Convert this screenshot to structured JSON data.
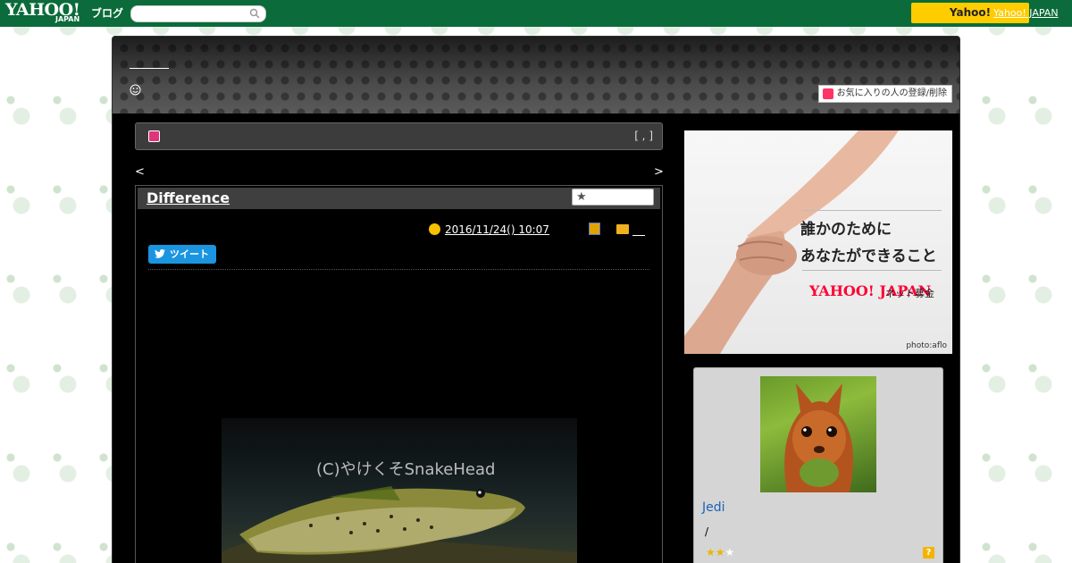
{
  "masthead": {
    "logo_text": "YAHOO!",
    "logo_sub": "JAPAN",
    "blog_label": "ブログ",
    "search_placeholder": "",
    "yahoo_button_label": "Yahoo!",
    "japan_link": "Yahoo! JAPAN"
  },
  "header": {
    "blog_title": "",
    "favorite_button_label": "お気に入りの人の登録/削除"
  },
  "notice": {
    "bracket_text": "[ , ]"
  },
  "pager": {
    "prev_label": "<",
    "next_label": ">"
  },
  "post": {
    "title": "Difference",
    "date": "2016/11/24()  10:07",
    "tweet_label": "ツイート",
    "photo_watermark": "(C)やけくそSnakeHead"
  },
  "ad": {
    "line1": "誰かのために",
    "line2": "あなたができること",
    "logo": "YAHOO! JAPAN",
    "sub": "ネット募金",
    "credit": "photo:aflo"
  },
  "profile": {
    "name": "Jedi",
    "slash": "/",
    "rating_filled": 2,
    "rating_total": 3,
    "help_label": "?"
  }
}
